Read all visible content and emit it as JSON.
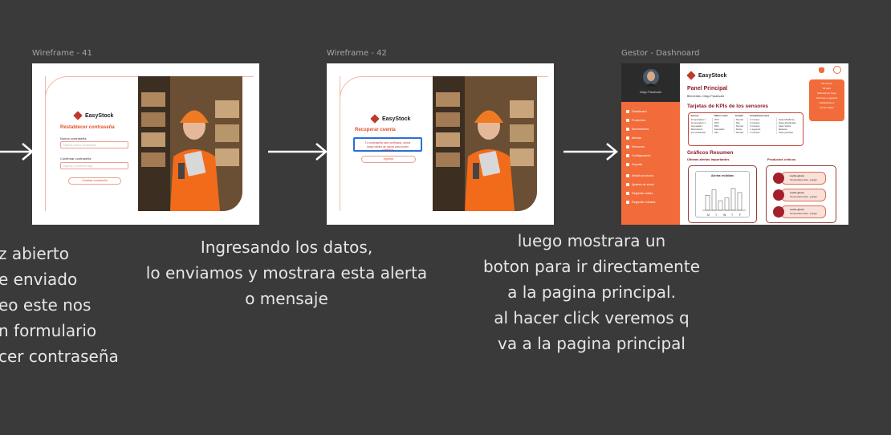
{
  "frames": {
    "wf41": {
      "label": "Wireframe - 41",
      "brand": "EasyStock",
      "title": "Restablecer contraseña",
      "field1_label": "Nueva contraseña",
      "field1_placeholder": "Ingrese nueva contraseña",
      "field2_label": "Confirmar contraseña",
      "field2_placeholder": "Ingrese y confirme aquí",
      "button": "Cambiar contraseña"
    },
    "wf42": {
      "label": "Wireframe - 42",
      "brand": "EasyStock",
      "title": "Recuperar cuenta",
      "alert": "Tu contraseña sido verificado, ahora",
      "alert_line2": "luego debes de iniciar para poder",
      "alert_line3": "continuar",
      "button": "Ingresar"
    },
    "dashboard": {
      "label": "Gestor - Dashnoard",
      "brand": "EasyStock",
      "user_name": "Diego Pacahuala",
      "page_title": "Panel Principal",
      "welcome": "Bienvenido, Diego Pacahuala",
      "kpi_title": "Tarjetas de KPIs de los sensores",
      "kpi_headers": [
        "Sensor",
        "Último valor",
        "Estado",
        "Actualizado hace",
        ""
      ],
      "kpi_rows": [
        [
          "Temperatura 1",
          "20°C",
          "Normal",
          "2 minutos",
          "Sede Miraflores"
        ],
        [
          "Temperatura 2",
          "25°C",
          "Alta",
          "3 minutos",
          "Diego Pacahuala"
        ],
        [
          "Humedad 1",
          "60%",
          "Normal",
          "5 minutos",
          "Sede Vitarte"
        ],
        [
          "Movimiento",
          "Detectado",
          "Alerta",
          "1 segundo",
          "Estantes"
        ],
        [
          "Luz Ambiental",
          "Alta",
          "Normal",
          "2 minutos",
          "Sede principal"
        ]
      ],
      "charts_title": "Gráficos Resumen",
      "alerts_subtitle": "Últimas alertas importantes",
      "alerts_chart_title": "Alertas recibidas",
      "alerts_days": [
        "M",
        "T",
        "W",
        "T",
        "F"
      ],
      "alerts_values": [
        2.2,
        3,
        1.4,
        1.8,
        3.2,
        2.6
      ],
      "products_subtitle": "Productos críticos",
      "products": [
        {
          "name": "Leche gloria",
          "detail": "Temperatura alta - peligro"
        },
        {
          "name": "Leche gloria",
          "detail": "Temperatura alta - peligro"
        },
        {
          "name": "Leche gloria",
          "detail": "Temperatura alta - peligro"
        }
      ],
      "sidebar_items": [
        "Dashboard",
        "Productos",
        "Movimientos",
        "Alertas",
        "Sensores",
        "Configuración",
        "Soporte"
      ],
      "sidebar_items2": [
        "Añadir producto",
        "Ajustes de stock",
        "Registrar salida",
        "Registrar entrada"
      ],
      "top_menu": [
        "Mi cuenta",
        "Mi plan",
        "Métodos de Pago",
        "Informes y registros",
        "Notificaciones",
        "Cerrar sesión"
      ]
    }
  },
  "captions": {
    "left": [
      "z abierto",
      "e enviado",
      "eo este nos",
      "n formulario",
      "cer contraseña"
    ],
    "middle": [
      "Ingresando los datos,",
      "lo enviamos y mostrara esta alerta",
      "o mensaje"
    ],
    "right": [
      "luego mostrara un",
      "boton para ir directamente",
      "a la pagina principal.",
      "al hacer click veremos q",
      "va a la pagina principal"
    ]
  },
  "colors": {
    "background": "#3a3a3a",
    "accent": "#f26b3a",
    "brand_dark": "#8b1a2a",
    "alert_border": "#2a6fdb"
  }
}
